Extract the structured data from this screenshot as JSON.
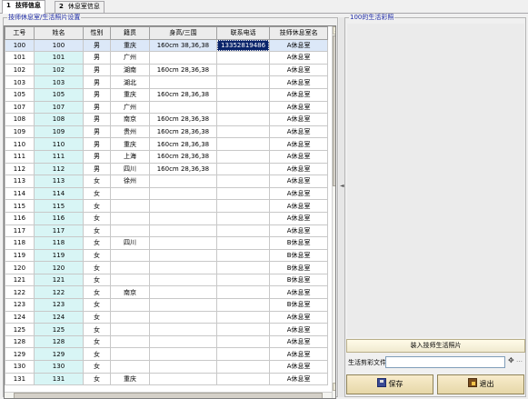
{
  "tabs": [
    {
      "num": "1",
      "label": "技师信息"
    },
    {
      "num": "2",
      "label": "休息室信息"
    }
  ],
  "left_panel": {
    "title": "技师休息室/生活照片设置",
    "columns": [
      "工号",
      "姓名",
      "性别",
      "籍贯",
      "身高/三围",
      "联系电话",
      "技师休息室名"
    ],
    "rows": [
      {
        "id": "100",
        "name": "100",
        "gender": "男",
        "origin": "重庆",
        "body": "160cm 38,36,38",
        "phone": "13352819486",
        "room": "A休息室"
      },
      {
        "id": "101",
        "name": "101",
        "gender": "男",
        "origin": "广州",
        "body": "",
        "phone": "",
        "room": "A休息室"
      },
      {
        "id": "102",
        "name": "102",
        "gender": "男",
        "origin": "湖南",
        "body": "160cm 28,36,38",
        "phone": "",
        "room": "A休息室"
      },
      {
        "id": "103",
        "name": "103",
        "gender": "男",
        "origin": "湖北",
        "body": "",
        "phone": "",
        "room": "A休息室"
      },
      {
        "id": "105",
        "name": "105",
        "gender": "男",
        "origin": "重庆",
        "body": "160cm 28,36,38",
        "phone": "",
        "room": "A休息室"
      },
      {
        "id": "107",
        "name": "107",
        "gender": "男",
        "origin": "广州",
        "body": "",
        "phone": "",
        "room": "A休息室"
      },
      {
        "id": "108",
        "name": "108",
        "gender": "男",
        "origin": "南京",
        "body": "160cm 28,36,38",
        "phone": "",
        "room": "A休息室"
      },
      {
        "id": "109",
        "name": "109",
        "gender": "男",
        "origin": "贵州",
        "body": "160cm 28,36,38",
        "phone": "",
        "room": "A休息室"
      },
      {
        "id": "110",
        "name": "110",
        "gender": "男",
        "origin": "重庆",
        "body": "160cm 28,36,38",
        "phone": "",
        "room": "A休息室"
      },
      {
        "id": "111",
        "name": "111",
        "gender": "男",
        "origin": "上海",
        "body": "160cm 28,36,38",
        "phone": "",
        "room": "A休息室"
      },
      {
        "id": "112",
        "name": "112",
        "gender": "男",
        "origin": "四川",
        "body": "160cm 28,36,38",
        "phone": "",
        "room": "A休息室"
      },
      {
        "id": "113",
        "name": "113",
        "gender": "女",
        "origin": "徐州",
        "body": "",
        "phone": "",
        "room": "A休息室"
      },
      {
        "id": "114",
        "name": "114",
        "gender": "女",
        "origin": "",
        "body": "",
        "phone": "",
        "room": "A休息室"
      },
      {
        "id": "115",
        "name": "115",
        "gender": "女",
        "origin": "",
        "body": "",
        "phone": "",
        "room": "A休息室"
      },
      {
        "id": "116",
        "name": "116",
        "gender": "女",
        "origin": "",
        "body": "",
        "phone": "",
        "room": "A休息室"
      },
      {
        "id": "117",
        "name": "117",
        "gender": "女",
        "origin": "",
        "body": "",
        "phone": "",
        "room": "A休息室"
      },
      {
        "id": "118",
        "name": "118",
        "gender": "女",
        "origin": "四川",
        "body": "",
        "phone": "",
        "room": "B休息室"
      },
      {
        "id": "119",
        "name": "119",
        "gender": "女",
        "origin": "",
        "body": "",
        "phone": "",
        "room": "B休息室"
      },
      {
        "id": "120",
        "name": "120",
        "gender": "女",
        "origin": "",
        "body": "",
        "phone": "",
        "room": "B休息室"
      },
      {
        "id": "121",
        "name": "121",
        "gender": "女",
        "origin": "",
        "body": "",
        "phone": "",
        "room": "B休息室"
      },
      {
        "id": "122",
        "name": "122",
        "gender": "女",
        "origin": "南京",
        "body": "",
        "phone": "",
        "room": "A休息室"
      },
      {
        "id": "123",
        "name": "123",
        "gender": "女",
        "origin": "",
        "body": "",
        "phone": "",
        "room": "B休息室"
      },
      {
        "id": "124",
        "name": "124",
        "gender": "女",
        "origin": "",
        "body": "",
        "phone": "",
        "room": "A休息室"
      },
      {
        "id": "125",
        "name": "125",
        "gender": "女",
        "origin": "",
        "body": "",
        "phone": "",
        "room": "A休息室"
      },
      {
        "id": "128",
        "name": "128",
        "gender": "女",
        "origin": "",
        "body": "",
        "phone": "",
        "room": "A休息室"
      },
      {
        "id": "129",
        "name": "129",
        "gender": "女",
        "origin": "",
        "body": "",
        "phone": "",
        "room": "A休息室"
      },
      {
        "id": "130",
        "name": "130",
        "gender": "女",
        "origin": "",
        "body": "",
        "phone": "",
        "room": "A休息室"
      },
      {
        "id": "131",
        "name": "131",
        "gender": "女",
        "origin": "重庆",
        "body": "",
        "phone": "",
        "room": "A休息室"
      }
    ],
    "selected_row_index": 0
  },
  "right_panel": {
    "title": "100的生活彩照",
    "load_button": "装入技师生活照片",
    "file_label": "生活剪彩文件",
    "file_value": "",
    "save_button": "保存",
    "exit_button": "退出"
  },
  "colors": {
    "title_blue": "#1d2aa6",
    "name_column_bg": "#d8f5f5",
    "selection_bg": "#0a246a",
    "selected_row_bg": "#dce8f8"
  }
}
